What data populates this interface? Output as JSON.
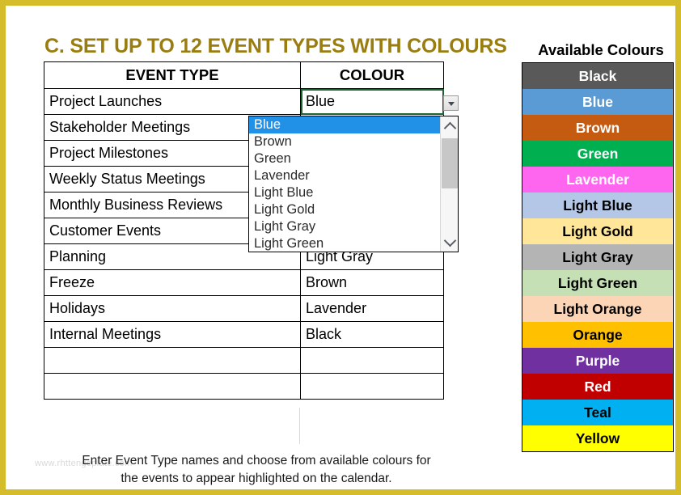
{
  "frame": {
    "border_color": "#d4bc2a"
  },
  "title": "C. SET UP TO 12 EVENT TYPES WITH COLOURS",
  "title_color": "#9a7d11",
  "event_table": {
    "headers": {
      "event_type": "EVENT TYPE",
      "colour": "COLOUR"
    },
    "rows": [
      {
        "event_type": "Project Launches",
        "colour": "Blue"
      },
      {
        "event_type": "Stakeholder Meetings",
        "colour": ""
      },
      {
        "event_type": "Project Milestones",
        "colour": ""
      },
      {
        "event_type": "Weekly Status Meetings",
        "colour": ""
      },
      {
        "event_type": "Monthly Business Reviews",
        "colour": ""
      },
      {
        "event_type": "Customer Events",
        "colour": ""
      },
      {
        "event_type": "Planning",
        "colour": "Light Gray"
      },
      {
        "event_type": "Freeze",
        "colour": "Brown"
      },
      {
        "event_type": "Holidays",
        "colour": "Lavender"
      },
      {
        "event_type": "Internal Meetings",
        "colour": "Black"
      },
      {
        "event_type": "",
        "colour": ""
      },
      {
        "event_type": "",
        "colour": ""
      }
    ],
    "selected_cell": {
      "row": 0,
      "column": "colour",
      "value": "Blue",
      "outline_color": "#1f6334"
    }
  },
  "dropdown": {
    "open": true,
    "selected_value": "Blue",
    "highlight_color": "#2191e8",
    "visible_options": [
      "Blue",
      "Brown",
      "Green",
      "Lavender",
      "Light Blue",
      "Light Gold",
      "Light Gray",
      "Light Green"
    ],
    "scrollbar": {
      "up_arrow": "chevron-up",
      "down_arrow": "chevron-down",
      "thumb_color": "#c7c7c7"
    },
    "button_icon": "chevron-down-icon"
  },
  "available_colours": {
    "heading": "Available Colours",
    "swatches": [
      {
        "label": "Black",
        "bg": "#595959",
        "fg": "#ffffff"
      },
      {
        "label": "Blue",
        "bg": "#5b9bd5",
        "fg": "#ffffff"
      },
      {
        "label": "Brown",
        "bg": "#c55a11",
        "fg": "#ffffff"
      },
      {
        "label": "Green",
        "bg": "#00b050",
        "fg": "#ffffff"
      },
      {
        "label": "Lavender",
        "bg": "#ff66ef",
        "fg": "#ffffff"
      },
      {
        "label": "Light Blue",
        "bg": "#b4c7e7",
        "fg": "#000000"
      },
      {
        "label": "Light Gold",
        "bg": "#ffe699",
        "fg": "#000000"
      },
      {
        "label": "Light Gray",
        "bg": "#b4b4b4",
        "fg": "#000000"
      },
      {
        "label": "Light Green",
        "bg": "#c5e0b4",
        "fg": "#000000"
      },
      {
        "label": "Light Orange",
        "bg": "#fbd5b5",
        "fg": "#000000"
      },
      {
        "label": "Orange",
        "bg": "#ffc000",
        "fg": "#000000"
      },
      {
        "label": "Purple",
        "bg": "#7030a0",
        "fg": "#ffffff"
      },
      {
        "label": "Red",
        "bg": "#c00000",
        "fg": "#ffffff"
      },
      {
        "label": "Teal",
        "bg": "#00b0f0",
        "fg": "#000000"
      },
      {
        "label": "Yellow",
        "bg": "#ffff00",
        "fg": "#000000"
      }
    ]
  },
  "footer": {
    "line1": "Enter Event Type names and choose from available colours for",
    "line2": "the events to appear highlighted on the calendar.",
    "watermark": "www.rhttengeplate.com"
  }
}
